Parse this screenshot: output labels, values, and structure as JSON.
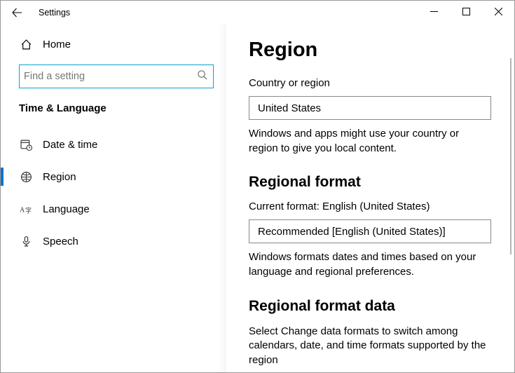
{
  "titlebar": {
    "title": "Settings"
  },
  "sidebar": {
    "home": "Home",
    "search_placeholder": "Find a setting",
    "category": "Time & Language",
    "items": [
      {
        "label": "Date & time"
      },
      {
        "label": "Region"
      },
      {
        "label": "Language"
      },
      {
        "label": "Speech"
      }
    ]
  },
  "main": {
    "title": "Region",
    "country_label": "Country or region",
    "country_value": "United States",
    "country_desc": "Windows and apps might use your country or region to give you local content.",
    "format_head": "Regional format",
    "format_current": "Current format: English (United States)",
    "format_value": "Recommended [English (United States)]",
    "format_desc": "Windows formats dates and times based on your language and regional preferences.",
    "data_head": "Regional format data",
    "data_desc": "Select Change data formats to switch among calendars, date, and time formats supported by the region"
  }
}
